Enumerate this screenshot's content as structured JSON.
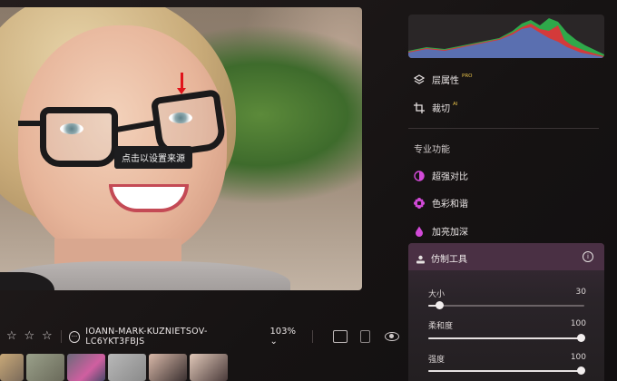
{
  "photo": {
    "tooltip": "点击以设置来源"
  },
  "toolbar": {
    "stars": [
      "star",
      "star",
      "star"
    ],
    "filename": "IOANN-MARK-KUZNIETSOV-LC6YKT3FBJS",
    "zoom": "103%",
    "zoom_caret": "⌄"
  },
  "right_panel": {
    "items": [
      {
        "label": "层属性",
        "badge": "PRO",
        "icon": "layers-icon"
      },
      {
        "label": "裁切",
        "badge": "AI",
        "icon": "crop-icon"
      }
    ],
    "section_title": "专业功能",
    "pro_items": [
      {
        "label": "超强对比",
        "icon": "contrast-icon"
      },
      {
        "label": "色彩和谐",
        "icon": "gear-flower-icon"
      },
      {
        "label": "加亮加深",
        "icon": "drop-icon"
      }
    ],
    "clone_tool": {
      "title": "仿制工具",
      "sliders": [
        {
          "label": "大小",
          "value": "30",
          "fraction": 0.03
        },
        {
          "label": "柔和度",
          "value": "100",
          "fraction": 1.0
        },
        {
          "label": "强度",
          "value": "100",
          "fraction": 1.0
        }
      ]
    }
  },
  "colors": {
    "accent_pink": "#d24ad8",
    "clone_header": "#4a3044",
    "marker_red": "#e0141b"
  }
}
